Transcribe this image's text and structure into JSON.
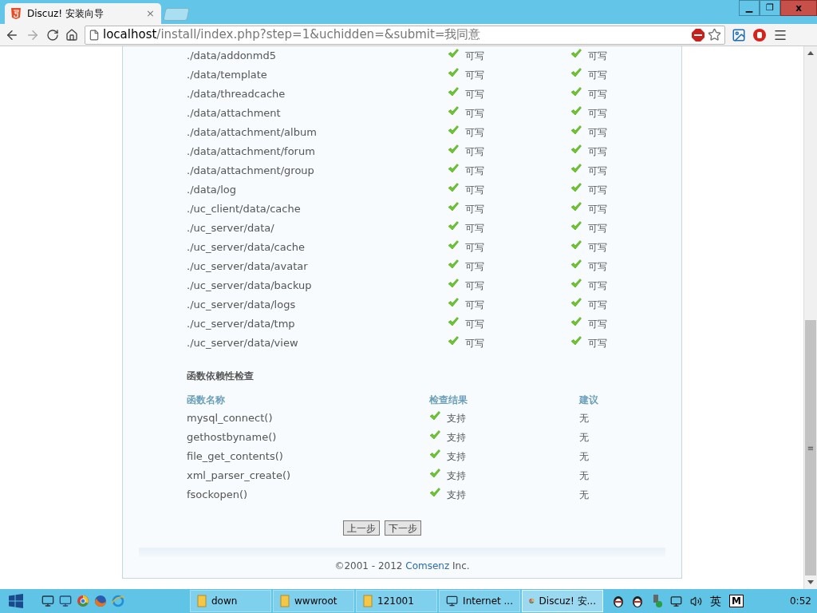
{
  "browser": {
    "tab": {
      "title": "Discuz! 安装向导",
      "close": "×"
    },
    "address": {
      "host": "localhost",
      "path": "/install/index.php?step=1&uchidden=&submit=我同意"
    },
    "window_controls": {
      "minimize": "▁",
      "restore": "❐",
      "close": "x"
    }
  },
  "directory_rows": [
    {
      "path": "./data/addonmd5",
      "current": "可写",
      "required": "可写"
    },
    {
      "path": "./data/template",
      "current": "可写",
      "required": "可写"
    },
    {
      "path": "./data/threadcache",
      "current": "可写",
      "required": "可写"
    },
    {
      "path": "./data/attachment",
      "current": "可写",
      "required": "可写"
    },
    {
      "path": "./data/attachment/album",
      "current": "可写",
      "required": "可写"
    },
    {
      "path": "./data/attachment/forum",
      "current": "可写",
      "required": "可写"
    },
    {
      "path": "./data/attachment/group",
      "current": "可写",
      "required": "可写"
    },
    {
      "path": "./data/log",
      "current": "可写",
      "required": "可写"
    },
    {
      "path": "./uc_client/data/cache",
      "current": "可写",
      "required": "可写"
    },
    {
      "path": "./uc_server/data/",
      "current": "可写",
      "required": "可写"
    },
    {
      "path": "./uc_server/data/cache",
      "current": "可写",
      "required": "可写"
    },
    {
      "path": "./uc_server/data/avatar",
      "current": "可写",
      "required": "可写"
    },
    {
      "path": "./uc_server/data/backup",
      "current": "可写",
      "required": "可写"
    },
    {
      "path": "./uc_server/data/logs",
      "current": "可写",
      "required": "可写"
    },
    {
      "path": "./uc_server/data/tmp",
      "current": "可写",
      "required": "可写"
    },
    {
      "path": "./uc_server/data/view",
      "current": "可写",
      "required": "可写"
    }
  ],
  "function_check": {
    "title": "函数依赖性检查",
    "columns": [
      "函数名称",
      "检查结果",
      "建议"
    ],
    "rows": [
      {
        "name": "mysql_connect()",
        "result": "支持",
        "advice": "无"
      },
      {
        "name": "gethostbyname()",
        "result": "支持",
        "advice": "无"
      },
      {
        "name": "file_get_contents()",
        "result": "支持",
        "advice": "无"
      },
      {
        "name": "xml_parser_create()",
        "result": "支持",
        "advice": "无"
      },
      {
        "name": "fsockopen()",
        "result": "支持",
        "advice": "无"
      }
    ]
  },
  "buttons": [
    "上一步",
    "下一步"
  ],
  "footer": {
    "before": "©2001 - 2012 ",
    "link": "Comsenz",
    "after": " Inc."
  },
  "scrollbar": {
    "grip": "≡"
  },
  "taskbar": {
    "windows": [
      {
        "label": "down",
        "kind": "folder",
        "selected": false
      },
      {
        "label": "wwwroot",
        "kind": "folder",
        "selected": false
      },
      {
        "label": "121001",
        "kind": "folder",
        "selected": false
      },
      {
        "label": "Internet ...",
        "kind": "network",
        "selected": false
      },
      {
        "label": "Discuz! 安...",
        "kind": "browser",
        "selected": true
      }
    ],
    "ime": "英",
    "ime_mode": "M",
    "clock": "0:52"
  }
}
